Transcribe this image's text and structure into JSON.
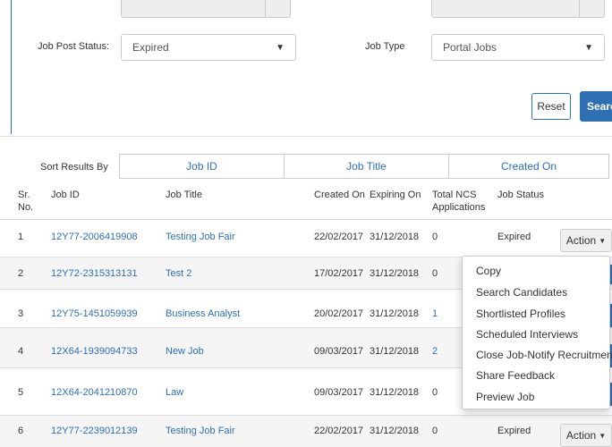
{
  "filters": {
    "job_post_status_label": "Job Post Status:",
    "job_post_status_value": "Expired",
    "job_type_label": "Job Type",
    "job_type_value": "Portal Jobs",
    "reset_label": "Reset",
    "search_label": "Search"
  },
  "sort": {
    "label": "Sort Results By",
    "tabs": [
      "Job ID",
      "Job Title",
      "Created On"
    ]
  },
  "table": {
    "headers": {
      "sr": "Sr.",
      "no": "No.",
      "job_id": "Job ID",
      "job_title": "Job Title",
      "created_on": "Created On",
      "expiring_on": "Expiring On",
      "total_ncs": "Total NCS",
      "applications": "Applications",
      "job_status": "Job Status"
    },
    "rows": [
      {
        "sr": "1",
        "job_id": "12Y77-2006419908",
        "title": "Testing Job Fair",
        "created": "22/02/2017",
        "expiring": "31/12/2018",
        "apps": "0",
        "status": "Expired"
      },
      {
        "sr": "2",
        "job_id": "12Y72-2315313131",
        "title": "Test 2",
        "created": "17/02/2017",
        "expiring": "31/12/2018",
        "apps": "0",
        "status": ""
      },
      {
        "sr": "3",
        "job_id": "12Y75-1451059939",
        "title": "Business Analyst",
        "created": "20/02/2017",
        "expiring": "31/12/2018",
        "apps": "1",
        "status": ""
      },
      {
        "sr": "4",
        "job_id": "12X64-1939094733",
        "title": "New Job",
        "created": "09/03/2017",
        "expiring": "31/12/2018",
        "apps": "2",
        "status": ""
      },
      {
        "sr": "5",
        "job_id": "12X64-2041210870",
        "title": "Law",
        "created": "09/03/2017",
        "expiring": "31/12/2018",
        "apps": "0",
        "status": ""
      },
      {
        "sr": "6",
        "job_id": "12Y77-2239012139",
        "title": "Testing Job Fair",
        "created": "22/02/2017",
        "expiring": "31/12/2018",
        "apps": "0",
        "status": "Expired"
      }
    ],
    "action_label": "Action"
  },
  "action_menu": {
    "items": [
      "Copy",
      "Search Candidates",
      "Shortlisted Profiles",
      "Scheduled Interviews",
      "Close Job-Notify Recruitment",
      "Share Feedback",
      "Preview Job"
    ]
  },
  "colors": {
    "accent": "#2f6fb3",
    "border": "#cccccc"
  }
}
